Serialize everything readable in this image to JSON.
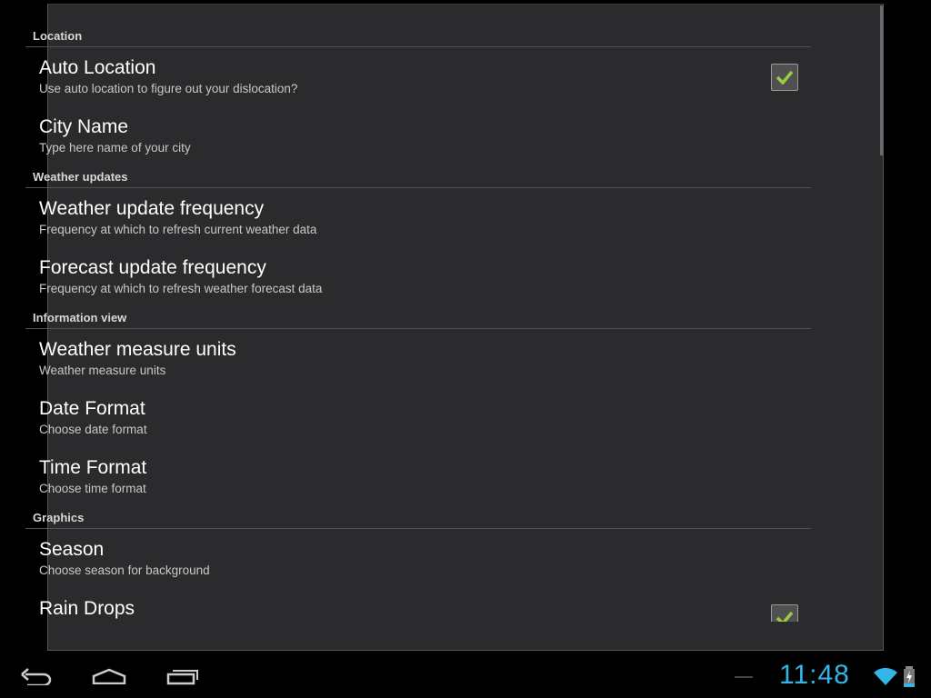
{
  "colors": {
    "accent": "#33b5e5",
    "check": "#9ccc3c"
  },
  "sections": [
    {
      "header": "Location",
      "items": [
        {
          "title": "Auto Location",
          "subtitle": "Use auto location to figure out your dislocation?",
          "checkbox": true,
          "checked": true
        },
        {
          "title": "City Name",
          "subtitle": "Type here name of your city"
        }
      ]
    },
    {
      "header": "Weather updates",
      "items": [
        {
          "title": "Weather update frequency",
          "subtitle": "Frequency at which to refresh current weather data"
        },
        {
          "title": "Forecast update frequency",
          "subtitle": "Frequency at which to refresh weather forecast data"
        }
      ]
    },
    {
      "header": "Information view",
      "items": [
        {
          "title": "Weather measure units",
          "subtitle": "Weather measure units"
        },
        {
          "title": "Date Format",
          "subtitle": "Choose date format"
        },
        {
          "title": "Time Format",
          "subtitle": "Choose time format"
        }
      ]
    },
    {
      "header": "Graphics",
      "items": [
        {
          "title": "Season",
          "subtitle": "Choose season for background"
        },
        {
          "title": "Rain Drops",
          "subtitle": "",
          "checkbox": true,
          "checked": true
        }
      ]
    }
  ],
  "status": {
    "time": "11:48",
    "icons": [
      "wifi-icon",
      "battery-charging-icon"
    ]
  },
  "navbar": [
    "back-icon",
    "home-icon",
    "recent-apps-icon"
  ]
}
